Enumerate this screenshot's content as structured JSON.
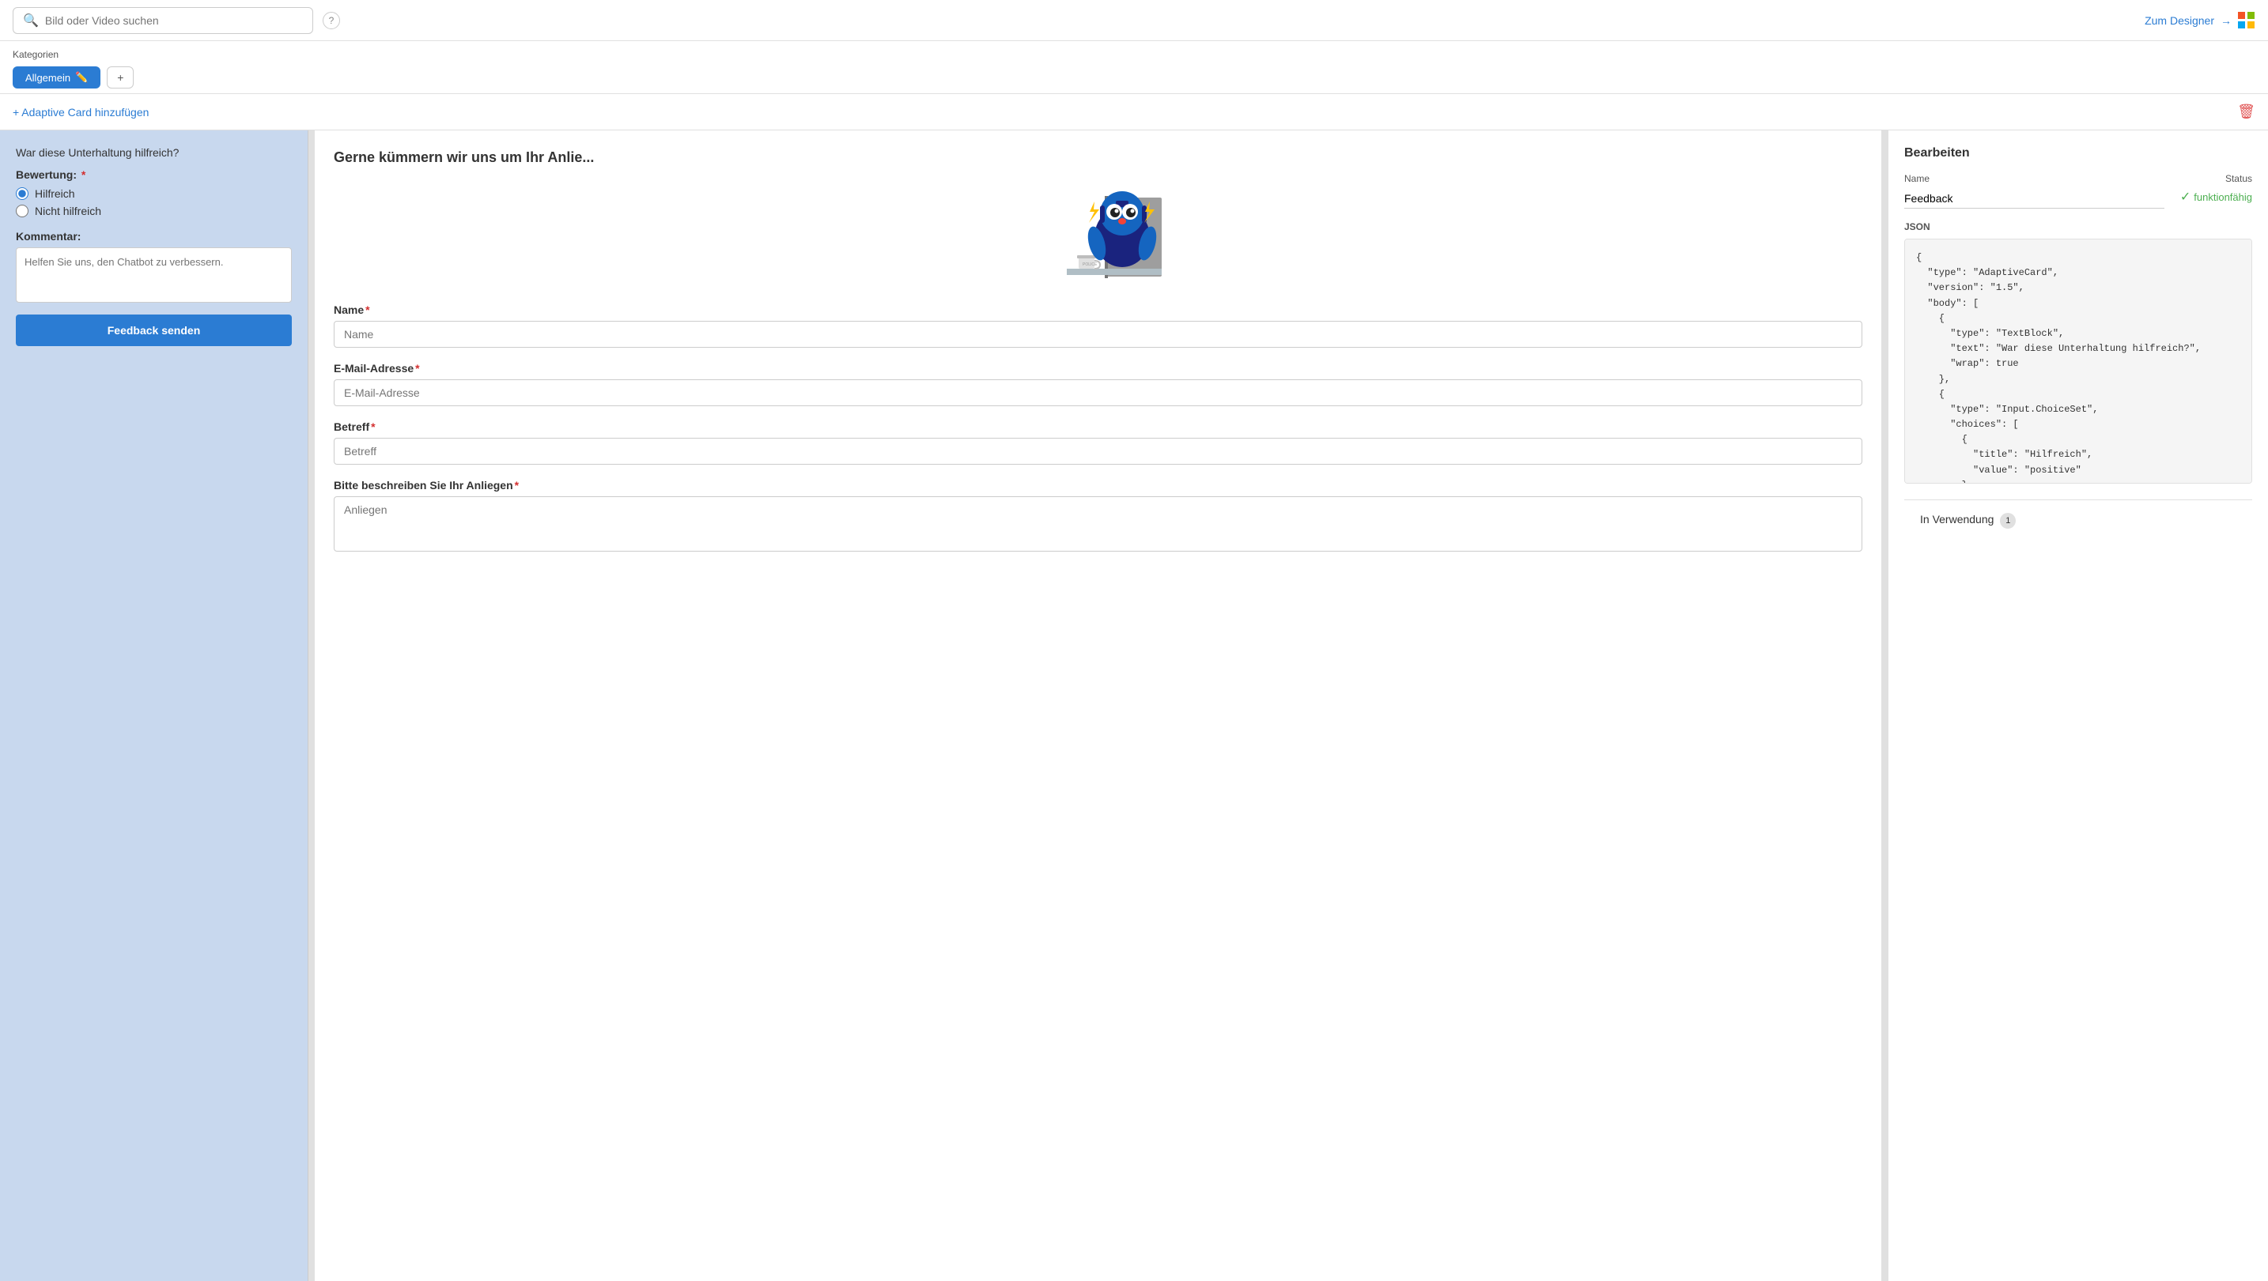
{
  "topbar": {
    "search_placeholder": "Bild oder Video suchen",
    "designer_link": "Zum Designer",
    "designer_arrow": "→"
  },
  "categories": {
    "label": "Kategorien",
    "active_tab": "Allgemein",
    "add_label": "+"
  },
  "add_card": {
    "label": "+ Adaptive Card hinzufügen"
  },
  "card_preview": {
    "question": "War diese Unterhaltung hilfreich?",
    "rating_label": "Bewertung:",
    "options": [
      "Hilfreich",
      "Nicht hilfreich"
    ],
    "comment_label": "Kommentar:",
    "comment_placeholder": "Helfen Sie uns, den Chatbot zu verbessern.",
    "submit_button": "Feedback senden"
  },
  "form_preview": {
    "title": "Gerne kümmern wir uns um Ihr Anlie...",
    "name_label": "Name",
    "name_placeholder": "Name",
    "email_label": "E-Mail-Adresse",
    "email_placeholder": "E-Mail-Adresse",
    "subject_label": "Betreff",
    "subject_placeholder": "Betreff",
    "description_label": "Bitte beschreiben Sie Ihr Anliegen",
    "description_placeholder": "Anliegen"
  },
  "editor": {
    "title": "Bearbeiten",
    "name_label": "Name",
    "name_value": "Feedback",
    "status_label": "Status",
    "status_value": "funktionfähig",
    "json_label": "JSON",
    "json_content": "{\n  \"type\": \"AdaptiveCard\",\n  \"version\": \"1.5\",\n  \"body\": [\n    {\n      \"type\": \"TextBlock\",\n      \"text\": \"War diese Unterhaltung hilfreich?\",\n      \"wrap\": true\n    },\n    {\n      \"type\": \"Input.ChoiceSet\",\n      \"choices\": [\n        {\n          \"title\": \"Hilfreich\",\n          \"value\": \"positive\"\n        },"
  },
  "in_verwendung": {
    "title": "In Verwendung",
    "count": "1"
  }
}
